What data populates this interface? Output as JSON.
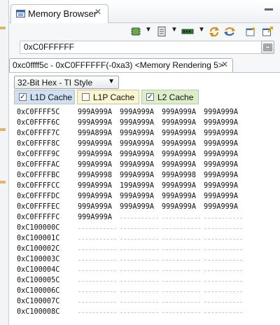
{
  "view": {
    "title": "Memory Browser",
    "close_icon": "close-icon",
    "minimize_icon": "minimize-icon"
  },
  "toolbar": {
    "icons": [
      "chip-icon",
      "dropdown-arrow-icon",
      "memory-card-icon",
      "dropdown-arrow-icon",
      "memory-stick-icon",
      "dropdown-arrow-icon",
      "refresh-icon",
      "sync-icon",
      "new-rendering-icon",
      "export-icon"
    ]
  },
  "address_bar": {
    "value": "0xC0FFFFFF",
    "go_icon": "go-icon"
  },
  "rendering_tab": {
    "title": "0xc0ffff5c - 0xC0FFFFFF(-0xa3) <Memory Rendering 5>"
  },
  "format": {
    "selected": "32-Bit Hex - TI Style"
  },
  "cache_options": [
    {
      "label": "L1D Cache",
      "checked": true,
      "color": "#cfe0f5"
    },
    {
      "label": "L1P Cache",
      "checked": false,
      "color": "#faf4cf"
    },
    {
      "label": "L2 Cache",
      "checked": true,
      "color": "#dbedc9"
    }
  ],
  "memory_rows": [
    {
      "address": "0xC0FFFF5C",
      "words": [
        "999A999A",
        "999A999A",
        "999A999A",
        "999A999A"
      ]
    },
    {
      "address": "0xC0FFFF6C",
      "words": [
        "999A999A",
        "999A999A",
        "999A999A",
        "999A999A"
      ]
    },
    {
      "address": "0xC0FFFF7C",
      "words": [
        "999A899A",
        "999A999A",
        "999A999A",
        "999A999A"
      ]
    },
    {
      "address": "0xC0FFFF8C",
      "words": [
        "999A999A",
        "999A999A",
        "999A999A",
        "999A999A"
      ]
    },
    {
      "address": "0xC0FFFF9C",
      "words": [
        "999A999A",
        "999A999A",
        "999A999A",
        "999A999A"
      ]
    },
    {
      "address": "0xC0FFFFAC",
      "words": [
        "999A999A",
        "999A999A",
        "999A999A",
        "999A999A"
      ]
    },
    {
      "address": "0xC0FFFFBC",
      "words": [
        "999A9998",
        "999A999A",
        "999A9998",
        "999A999A"
      ]
    },
    {
      "address": "0xC0FFFFCC",
      "words": [
        "999A999A",
        "199A999A",
        "999A999A",
        "999A999A"
      ]
    },
    {
      "address": "0xC0FFFFDC",
      "words": [
        "999A999A",
        "999A999A",
        "999A999A",
        "999A999A"
      ]
    },
    {
      "address": "0xC0FFFFEC",
      "words": [
        "999A999A",
        "999A999A",
        "999A999A",
        "999A999A"
      ]
    },
    {
      "address": "0xC0FFFFFC",
      "words": [
        "999A999A",
        "",
        "",
        ""
      ]
    },
    {
      "address": "0xC100000C",
      "words": [
        "",
        "",
        "",
        ""
      ]
    },
    {
      "address": "0xC100001C",
      "words": [
        "",
        "",
        "",
        ""
      ]
    },
    {
      "address": "0xC100002C",
      "words": [
        "",
        "",
        "",
        ""
      ]
    },
    {
      "address": "0xC100003C",
      "words": [
        "",
        "",
        "",
        ""
      ]
    },
    {
      "address": "0xC100004C",
      "words": [
        "",
        "",
        "",
        ""
      ]
    },
    {
      "address": "0xC100005C",
      "words": [
        "",
        "",
        "",
        ""
      ]
    },
    {
      "address": "0xC100006C",
      "words": [
        "",
        "",
        "",
        ""
      ]
    },
    {
      "address": "0xC100007C",
      "words": [
        "",
        "",
        "",
        ""
      ]
    },
    {
      "address": "0xC100008C",
      "words": [
        "",
        "",
        "",
        ""
      ]
    }
  ]
}
